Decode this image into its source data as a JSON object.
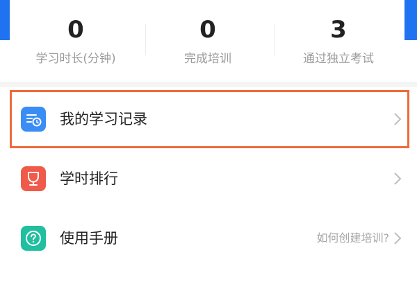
{
  "colors": {
    "header_blue": "#1f72f0",
    "highlight_orange": "#ef6a3a",
    "records_icon_bg": "#3a8df5",
    "ranking_icon_bg": "#ef5a4a",
    "manual_icon_bg": "#1fbf9f"
  },
  "stats": [
    {
      "value": "0",
      "label": "学习时长(分钟)"
    },
    {
      "value": "0",
      "label": "完成培训"
    },
    {
      "value": "3",
      "label": "通过独立考试"
    }
  ],
  "menu": {
    "records": {
      "label": "我的学习记录",
      "icon": "study-record-icon"
    },
    "ranking": {
      "label": "学时排行",
      "icon": "trophy-icon"
    },
    "manual": {
      "label": "使用手册",
      "icon": "help-icon",
      "hint": "如何创建培训?"
    }
  }
}
